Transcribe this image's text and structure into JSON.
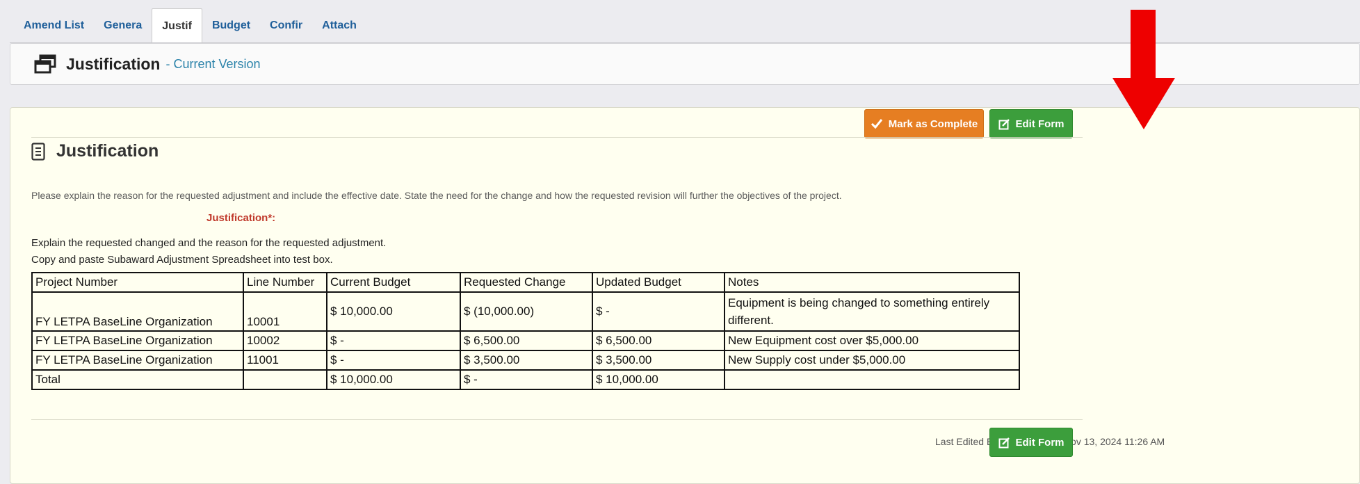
{
  "tabs": [
    "Amend List",
    "Genera",
    "Justif",
    "Budget",
    "Confir",
    "Attach"
  ],
  "version_bar": {
    "title": "Justification",
    "subtitle": "- Current Version"
  },
  "panel": {
    "title": "Justification",
    "mark_complete_label": "Mark as Complete",
    "edit_form_label": "Edit Form",
    "instructions": "Please explain the reason for the requested adjustment and include the effective date. State the need for the change and how the requested revision will further the objectives of the project.",
    "field_label": "Justification*:",
    "text_line1": "Explain the requested changed and the reason for the requested adjustment.",
    "text_line2": "Copy and paste Subaward Adjustment Spreadsheet into test box.",
    "last_edited": "Last Edited By: TEST TEST - Nov 13, 2024 11:26 AM"
  },
  "table": {
    "headers": [
      "Project Number",
      "Line Number",
      "Current Budget",
      "Requested Change",
      "Updated Budget",
      "Notes"
    ],
    "rows": [
      [
        "FY LETPA BaseLine Organization",
        "10001",
        "$ 10,000.00",
        "$ (10,000.00)",
        "$ -",
        "Equipment is being changed to something entirely different."
      ],
      [
        "FY LETPA BaseLine Organization",
        "10002",
        "$ -",
        "$ 6,500.00",
        "$ 6,500.00",
        "New Equipment cost over $5,000.00"
      ],
      [
        "FY LETPA BaseLine Organization",
        "11001",
        "$ -",
        "$ 3,500.00",
        "$ 3,500.00",
        "New Supply cost under $5,000.00"
      ],
      [
        "Total",
        "",
        "$ 10,000.00",
        "$ -",
        "$ 10,000.00",
        ""
      ]
    ]
  },
  "colors": {
    "tab_link": "#1f5f9a",
    "orange_button": "#e67e22",
    "green_button": "#3c9e3c",
    "required_red": "#c0392b",
    "arrow_red": "#ee0000",
    "panel_bg": "#fffff0"
  },
  "icons": {
    "version": "window-restore-icon",
    "panel": "document-icon",
    "complete": "checkmark-icon",
    "edit": "edit-icon"
  }
}
